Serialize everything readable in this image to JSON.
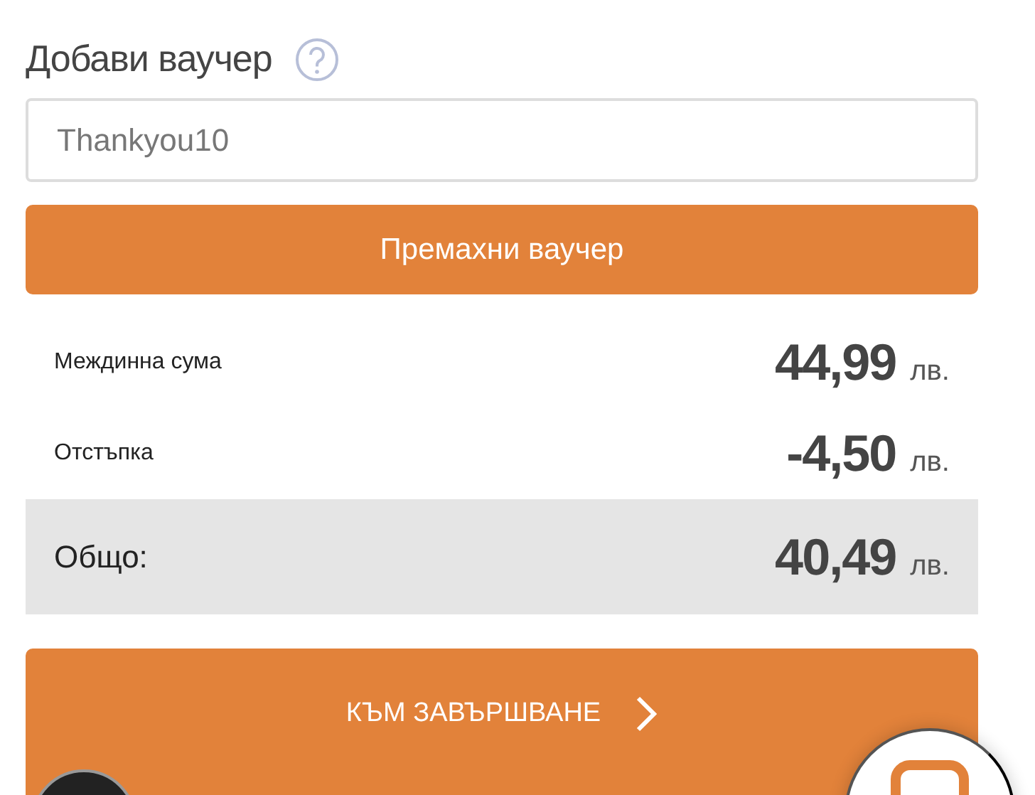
{
  "voucher": {
    "title": "Добави ваучер",
    "value": "Thankyou10",
    "button": "Премахни ваучер"
  },
  "summary": [
    {
      "kind": "line",
      "label": "Междинна сума",
      "amount": "44,99",
      "currency": "лв."
    },
    {
      "kind": "line",
      "label": "Отстъпка",
      "amount": "-4,50",
      "currency": "лв."
    },
    {
      "kind": "total",
      "label": "Общо:",
      "amount": "40,49",
      "currency": "лв."
    }
  ],
  "checkout": {
    "label": "КЪМ ЗАВЪРШВАНЕ"
  }
}
